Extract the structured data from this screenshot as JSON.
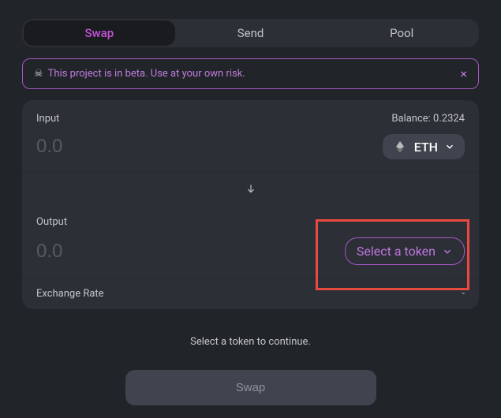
{
  "tabs": {
    "swap": "Swap",
    "send": "Send",
    "pool": "Pool"
  },
  "banner": {
    "icon": "☠",
    "message": "This project is in beta. Use at your own risk.",
    "close": "×"
  },
  "input": {
    "label": "Input",
    "balance_label": "Balance: 0.2324",
    "placeholder": "0.0",
    "value": "",
    "token": "ETH"
  },
  "output": {
    "label": "Output",
    "placeholder": "0.0",
    "value": "",
    "select_label": "Select a token"
  },
  "rate": {
    "label": "Exchange Rate",
    "value": "-"
  },
  "hint": "Select a token to continue.",
  "cta": "Swap"
}
